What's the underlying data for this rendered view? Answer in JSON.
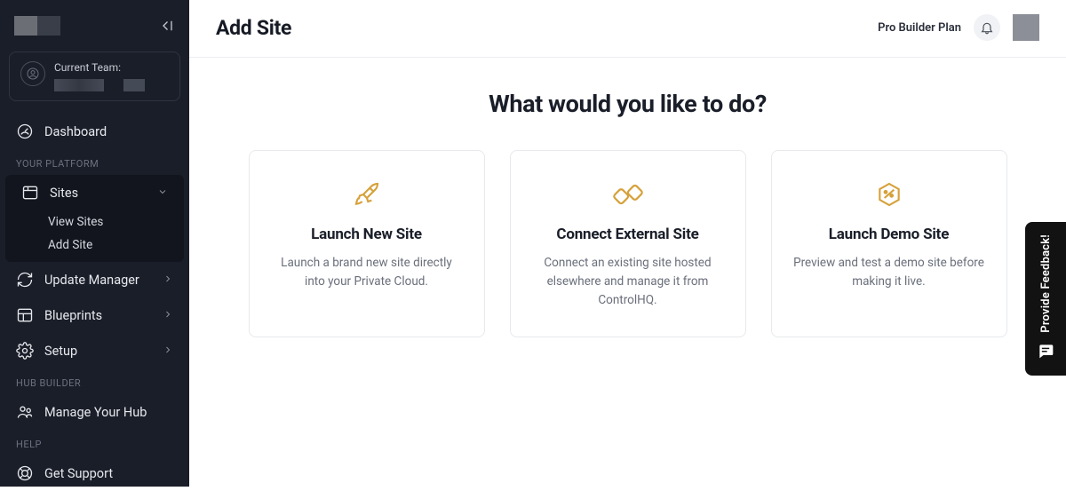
{
  "sidebar": {
    "team_label": "Current Team:",
    "nav": {
      "dashboard": "Dashboard",
      "section_platform": "YOUR PLATFORM",
      "sites": "Sites",
      "view_sites": "View Sites",
      "add_site": "Add Site",
      "update_manager": "Update Manager",
      "blueprints": "Blueprints",
      "setup": "Setup",
      "section_hub": "HUB BUILDER",
      "manage_hub": "Manage Your Hub",
      "section_help": "HELP",
      "get_support": "Get Support"
    }
  },
  "header": {
    "title": "Add Site",
    "plan": "Pro Builder Plan"
  },
  "main": {
    "question": "What would you like to do?",
    "cards": [
      {
        "title": "Launch New Site",
        "desc": "Launch a brand new site directly into your Private Cloud."
      },
      {
        "title": "Connect External Site",
        "desc": "Connect an existing site hosted elsewhere and manage it from ControlHQ."
      },
      {
        "title": "Launch Demo Site",
        "desc": "Preview and test a demo site before making it live."
      }
    ]
  },
  "feedback": {
    "label": "Provide Feedback!"
  }
}
